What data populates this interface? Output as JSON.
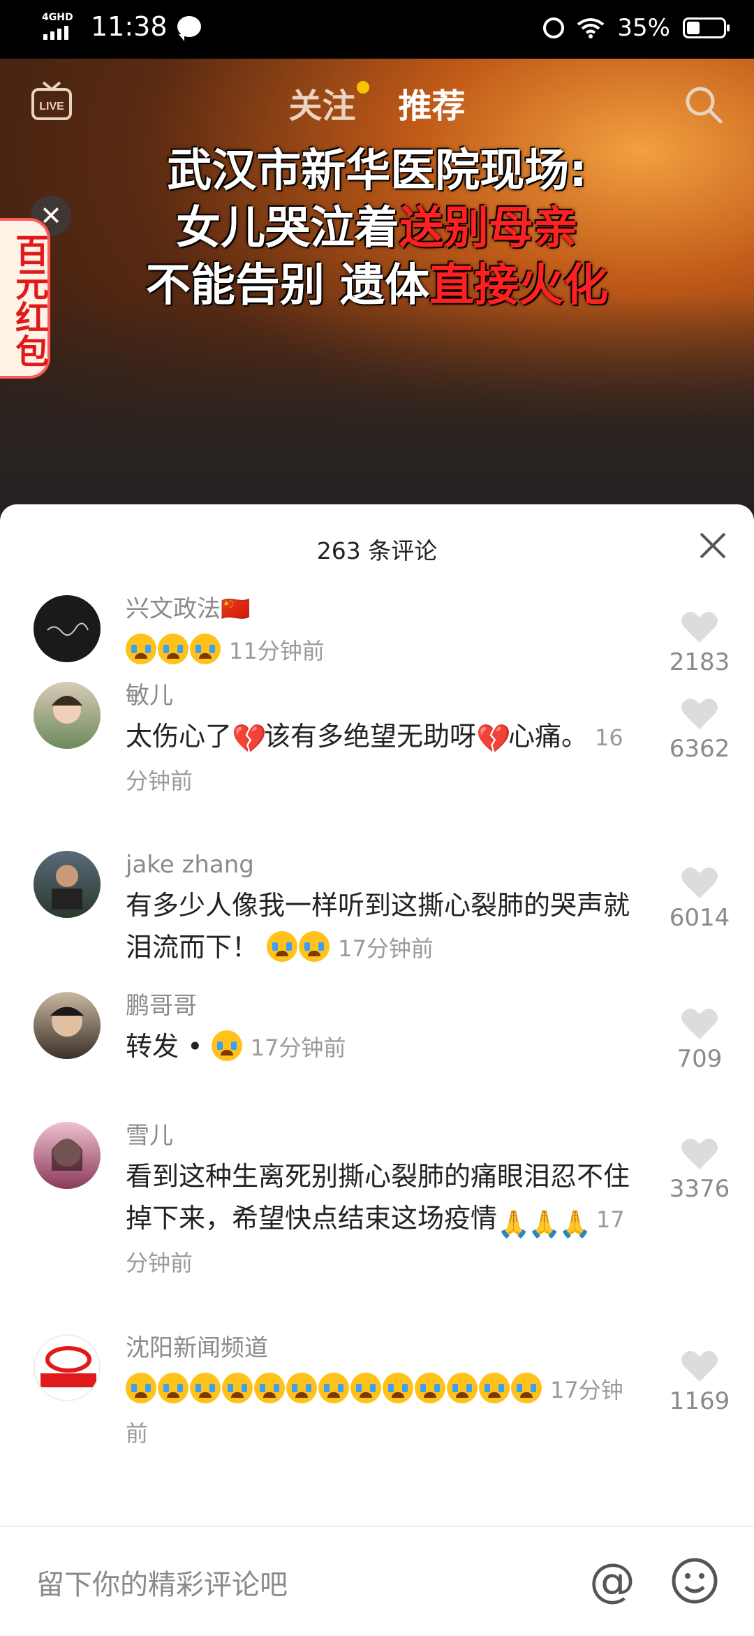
{
  "status_bar": {
    "network": "4GHD",
    "time": "11:38",
    "battery": "35%"
  },
  "video": {
    "tabs": [
      {
        "label": "关注"
      },
      {
        "label": "推荐"
      }
    ],
    "live_label": "LIVE",
    "headline": {
      "line1": "武汉市新华医院现场:",
      "line2_a": "女儿哭泣着",
      "line2_b": "送别母亲",
      "line3_a": "不能告别 遗体",
      "line3_b": "直接火化"
    },
    "red_packet": "百元红包"
  },
  "comments_sheet": {
    "title": "263 条评论",
    "comments": [
      {
        "user": "兴文政法🇨🇳",
        "text": "",
        "time": "11分钟前",
        "likes": "2183"
      },
      {
        "user": "敏儿",
        "text_a": "太伤心了",
        "text_b": "该有多绝望无助呀",
        "text_c": "心痛。",
        "time": "16分钟前",
        "likes": "6362"
      },
      {
        "user": "jake zhang",
        "text": "有多少人像我一样听到这撕心裂肺的哭声就泪流而下！",
        "time": "17分钟前",
        "likes": "6014"
      },
      {
        "user": "鹏哥哥",
        "text": "转发 •",
        "time": "17分钟前",
        "likes": "709"
      },
      {
        "user": "雪儿",
        "text": "看到这种生离死别撕心裂肺的痛眼泪忍不住掉下来，希望快点结束这场疫情",
        "time": "17分钟前",
        "likes": "3376"
      },
      {
        "user": "沈阳新闻频道",
        "text": "",
        "time": "17分钟前",
        "likes": "1169"
      }
    ]
  },
  "input": {
    "placeholder": "留下你的精彩评论吧"
  },
  "colors": {
    "accent_red": "#ff2020",
    "dot_yellow": "#f5c400",
    "emoji_yellow": "#ffc21a"
  }
}
